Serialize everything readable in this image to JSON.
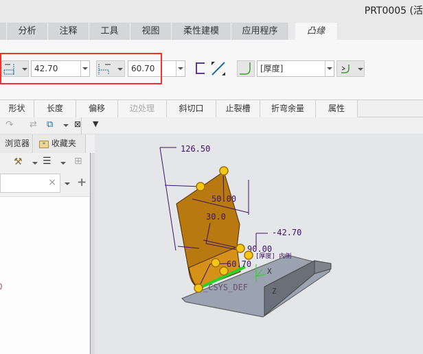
{
  "window": {
    "title": "PRT0005 (活"
  },
  "tabs": [
    {
      "label": "分析"
    },
    {
      "label": "注释"
    },
    {
      "label": "工具"
    },
    {
      "label": "视图"
    },
    {
      "label": "柔性建模"
    },
    {
      "label": "应用程序"
    },
    {
      "label": "凸缘",
      "active": true
    }
  ],
  "ribbon": {
    "length1": "42.70",
    "length2": "60.70",
    "thickness_option": "[厚度]"
  },
  "subtabs": [
    {
      "label": "形状"
    },
    {
      "label": "长度"
    },
    {
      "label": "偏移"
    },
    {
      "label": "边处理",
      "disabled": true
    },
    {
      "label": "斜切口"
    },
    {
      "label": "止裂槽"
    },
    {
      "label": "折弯余量"
    },
    {
      "label": "属性"
    }
  ],
  "left_panel": {
    "tabs": [
      {
        "label": "浏览器"
      },
      {
        "label": "收藏夹"
      }
    ],
    "search": {
      "value": "",
      "clear": "×"
    },
    "tree_partial": "0"
  },
  "graphics": {
    "dimensions": [
      "126.50",
      "50.00",
      "30.0",
      "-42.70",
      "90.00",
      "60.70"
    ],
    "label_thickness": "[厚度] 内侧",
    "csys": "_CSYS_DEF",
    "axis_x": "X",
    "axis_z": "Z"
  },
  "colors": {
    "highlight": "#ee3333",
    "flange": "#b87a10",
    "handle": "#f5c518",
    "dim": "#3d1163"
  }
}
